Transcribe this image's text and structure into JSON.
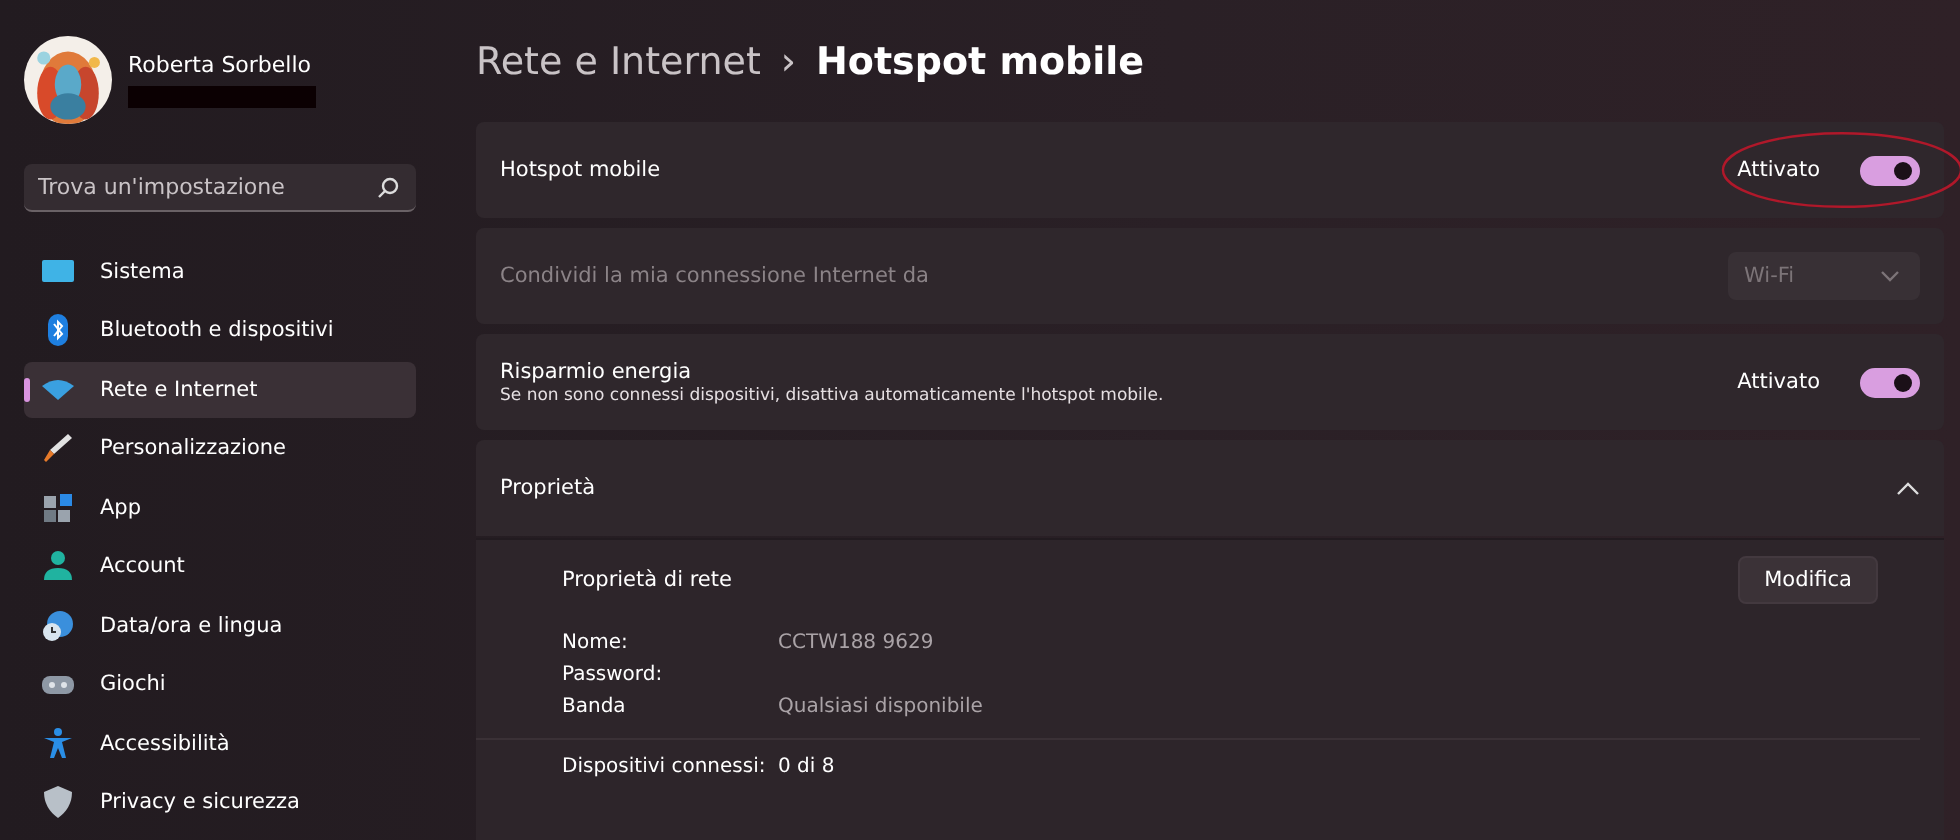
{
  "user": {
    "name": "Roberta Sorbello",
    "email_redacted": true
  },
  "search": {
    "placeholder": "Trova un'impostazione"
  },
  "sidebar": {
    "items": [
      {
        "label": "Sistema",
        "selected": false
      },
      {
        "label": "Bluetooth e dispositivi",
        "selected": false
      },
      {
        "label": "Rete e Internet",
        "selected": true
      },
      {
        "label": "Personalizzazione",
        "selected": false
      },
      {
        "label": "App",
        "selected": false
      },
      {
        "label": "Account",
        "selected": false
      },
      {
        "label": "Data/ora e lingua",
        "selected": false
      },
      {
        "label": "Giochi",
        "selected": false
      },
      {
        "label": "Accessibilità",
        "selected": false
      },
      {
        "label": "Privacy e sicurezza",
        "selected": false
      }
    ]
  },
  "breadcrumb": {
    "parent": "Rete e Internet",
    "separator": "›",
    "current": "Hotspot mobile"
  },
  "settings": [
    {
      "kind": "toggle",
      "label": "Hotspot mobile",
      "state_label": "Attivato",
      "on": true,
      "disabled": false,
      "highlighted": true
    },
    {
      "kind": "dropdown",
      "label": "Condividi la mia connessione Internet da",
      "value": "Wi-Fi",
      "disabled": true
    },
    {
      "kind": "toggle",
      "label": "Risparmio energia",
      "description": "Se non sono connessi dispositivi, disattiva automaticamente l'hotspot mobile.",
      "state_label": "Attivato",
      "on": true,
      "disabled": false,
      "highlighted": false
    }
  ],
  "properties": {
    "title": "Proprietà",
    "expanded": true,
    "section_title": "Proprietà di rete",
    "edit_button": "Modifica",
    "fields": [
      {
        "label": "Nome:",
        "value": "CCTW188 9629"
      },
      {
        "label": "Password:"
      },
      {
        "label": "Banda",
        "value": "Qualsiasi disponibile"
      }
    ],
    "connected": {
      "label": "Dispositivi connessi:",
      "value": "0 di 8"
    }
  }
}
